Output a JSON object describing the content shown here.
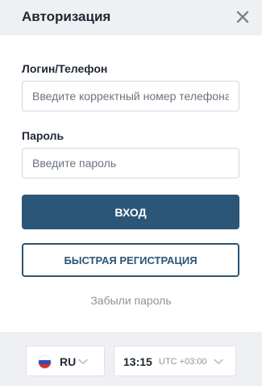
{
  "header": {
    "title": "Авторизация",
    "close_icon": "close-icon"
  },
  "form": {
    "login_label": "Логин/Телефон",
    "login_placeholder": "Введите корректный номер телефона",
    "login_value": "",
    "password_label": "Пароль",
    "password_placeholder": "Введите пароль",
    "password_value": "",
    "submit_label": "ВХОД",
    "register_label": "БЫСТРАЯ РЕГИСТРАЦИЯ",
    "forgot_label": "Забыли пароль"
  },
  "footer": {
    "language": {
      "flag_icon": "russia-flag-icon",
      "code": "RU"
    },
    "time": {
      "value": "13:15",
      "timezone": "UTC +03:00"
    }
  },
  "colors": {
    "primary": "#2b5677",
    "header_bg": "#eef0f3",
    "muted_text": "#8c939c"
  }
}
